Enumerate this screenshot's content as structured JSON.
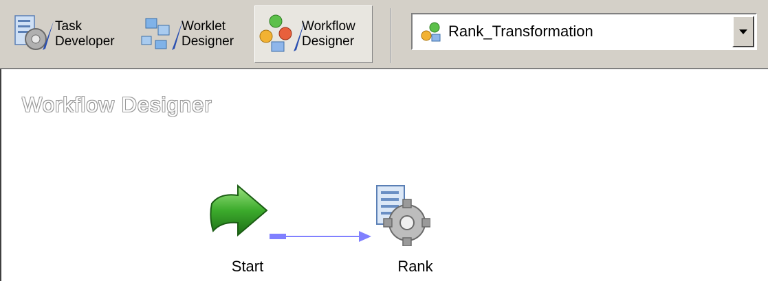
{
  "toolbar": {
    "tools": [
      {
        "label": "Task\nDeveloper"
      },
      {
        "label": "Worklet\nDesigner"
      },
      {
        "label": "Workflow\nDesigner"
      }
    ],
    "workflow_select": {
      "value": "Rank_Transformation"
    }
  },
  "canvas": {
    "title": "Workflow Designer",
    "nodes": [
      {
        "label": "Start",
        "icon": "start-arrow-icon"
      },
      {
        "label": "Rank",
        "icon": "session-gear-icon"
      }
    ]
  },
  "colors": {
    "toolbar_bg": "#d4d0c8",
    "link_color": "#8080ff",
    "start_green": "#3cab2c"
  }
}
